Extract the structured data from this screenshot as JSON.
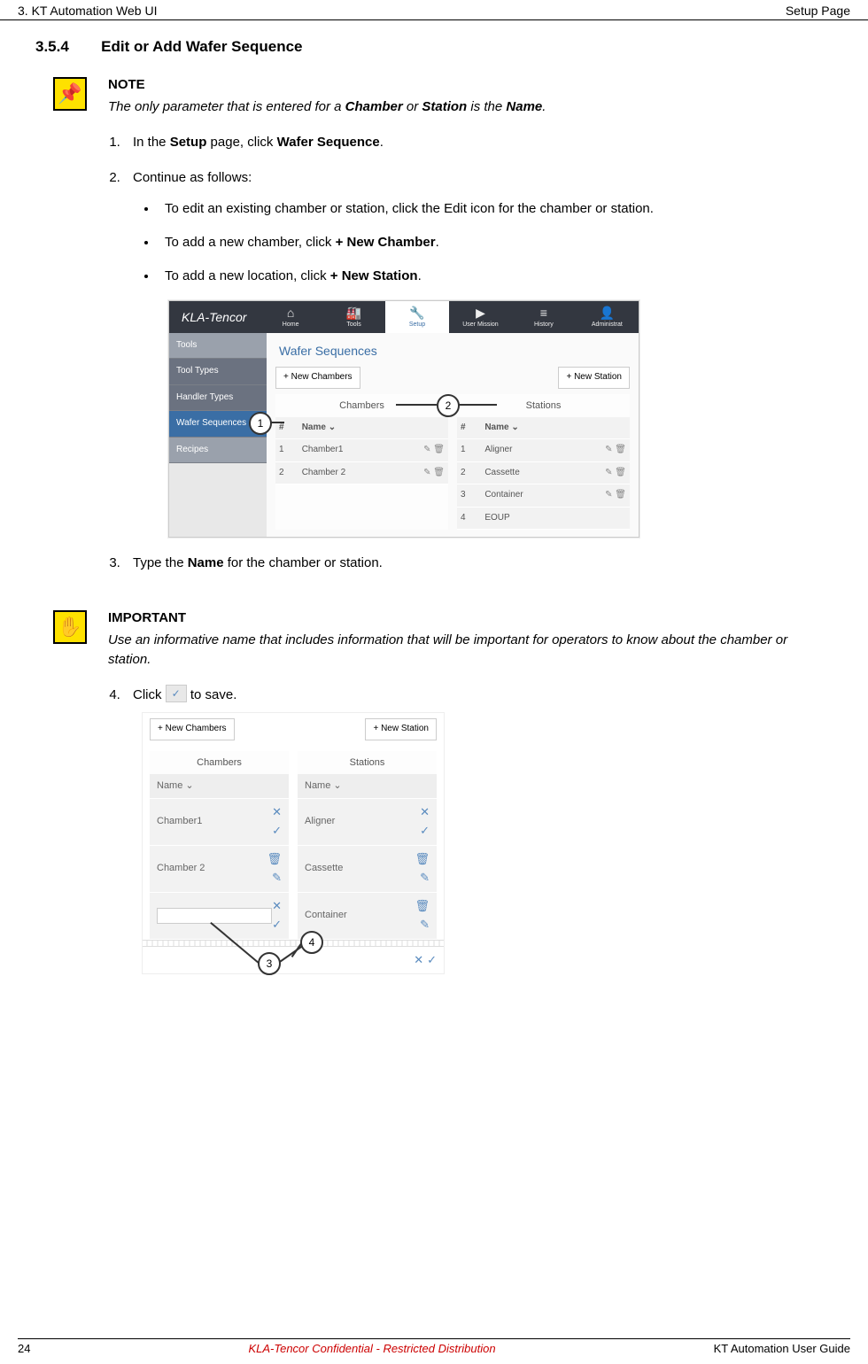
{
  "header": {
    "left": "3. KT Automation Web UI",
    "right": "Setup Page"
  },
  "section": {
    "num": "3.5.4",
    "title": "Edit or Add Wafer Sequence"
  },
  "note": {
    "heading": "NOTE",
    "text_pre": "The only parameter that is entered for a ",
    "bold1": "Chamber",
    "mid1": " or ",
    "bold2": "Station",
    "mid2": " is the ",
    "bold3": "Name",
    "post": "."
  },
  "step1": {
    "pre": "In the ",
    "b1": "Setup",
    "mid": " page, click ",
    "b2": "Wafer Sequence",
    "post": "."
  },
  "step2": {
    "text": "Continue as follows:"
  },
  "sub1": "To edit an existing chamber or station, click the Edit icon for the chamber or station.",
  "sub2": {
    "pre": "To add a new chamber, click ",
    "b": "+ New Chamber",
    "post": "."
  },
  "sub3": {
    "pre": "To add a new location, click ",
    "b": "+ New Station",
    "post": "."
  },
  "shot1": {
    "logo": "KLA-Tencor",
    "nav": [
      {
        "icon": "⌂",
        "lbl": "Home"
      },
      {
        "icon": "🏭",
        "lbl": "Tools"
      },
      {
        "icon": "🔧",
        "lbl": "Setup"
      },
      {
        "icon": "▶",
        "lbl": "User Mission"
      },
      {
        "icon": "≡",
        "lbl": "History"
      },
      {
        "icon": "👤",
        "lbl": "Administrat"
      }
    ],
    "sidebar": [
      "Tools",
      "Tool Types",
      "Handler Types",
      "Wafer Sequences",
      "Recipes"
    ],
    "panel_title": "Wafer Sequences",
    "btn_new_chambers": "+ New Chambers",
    "btn_new_station": "+ New Station",
    "col_chambers": "Chambers",
    "col_stations": "Stations",
    "th_num": "#",
    "th_name": "Name ⌄",
    "chambers": [
      {
        "n": "1",
        "name": "Chamber1"
      },
      {
        "n": "2",
        "name": "Chamber 2"
      }
    ],
    "stations": [
      {
        "n": "1",
        "name": "Aligner"
      },
      {
        "n": "2",
        "name": "Cassette"
      },
      {
        "n": "3",
        "name": "Container"
      },
      {
        "n": "4",
        "name": "EOUP"
      }
    ],
    "callout1": "1",
    "callout2": "2"
  },
  "step3": {
    "pre": "Type the ",
    "b": "Name",
    "post": " for the chamber or station."
  },
  "important": {
    "heading": "IMPORTANT",
    "text": "Use an informative name that includes information that will be important for operators to know about the chamber or station."
  },
  "step4": {
    "pre": "Click ",
    "post": " to save."
  },
  "shot2": {
    "btn_new_chambers": "+ New Chambers",
    "btn_new_station": "+ New Station",
    "col_chambers": "Chambers",
    "col_stations": "Stations",
    "th_name": "Name ⌄",
    "left_rows": [
      "Chamber1",
      "Chamber 2",
      ""
    ],
    "right_rows": [
      "Aligner",
      "Cassette",
      "Container"
    ],
    "callout3": "3",
    "callout4": "4"
  },
  "footer": {
    "page": "24",
    "center": "KLA-Tencor Confidential - Restricted Distribution",
    "right": "KT Automation User Guide"
  }
}
